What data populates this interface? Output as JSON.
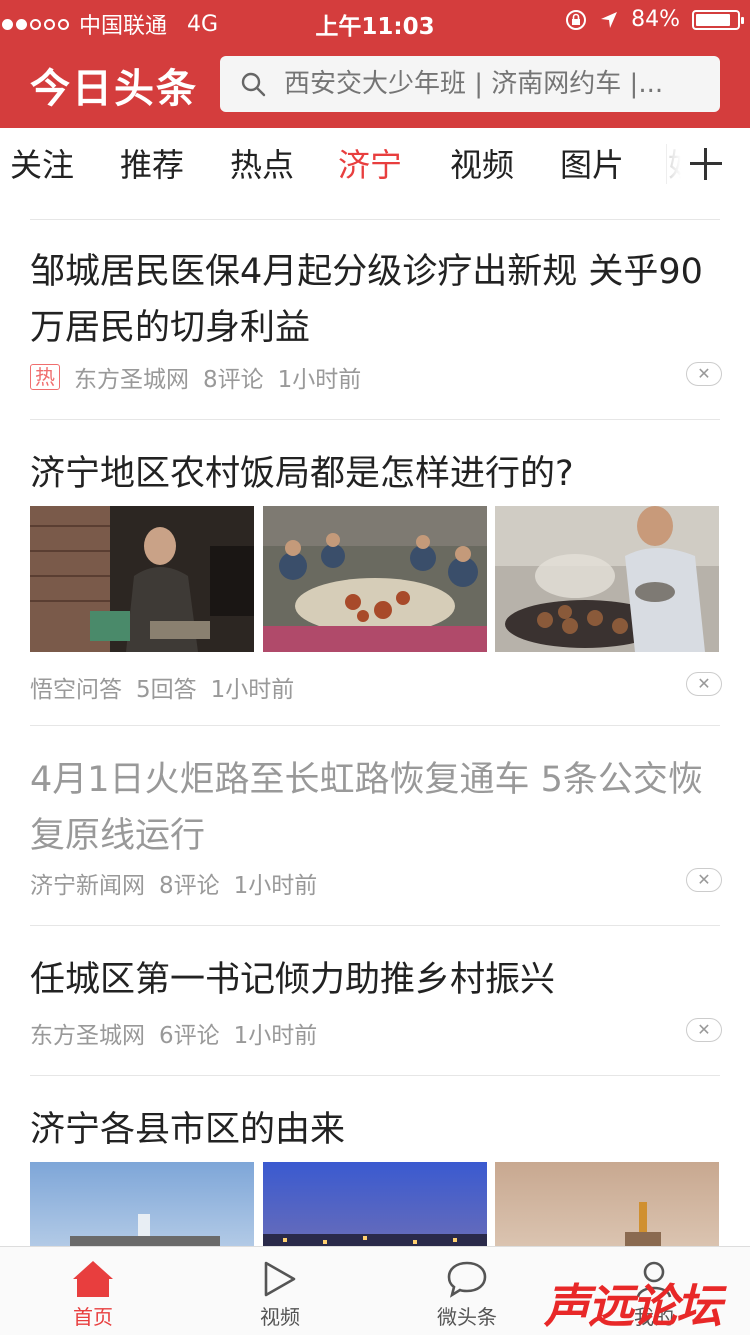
{
  "status_bar": {
    "carrier": "中国联通",
    "network": "4G",
    "time": "上午11:03",
    "battery_percent": "84%",
    "battery_level": 0.84,
    "signal_strength": 2
  },
  "header": {
    "logo": "今日头条",
    "search_placeholder": "西安交大少年班 | 济南网约车 |..."
  },
  "tabs": [
    {
      "label": "关注"
    },
    {
      "label": "推荐"
    },
    {
      "label": "热点"
    },
    {
      "label": "济宁",
      "active": true
    },
    {
      "label": "视频"
    },
    {
      "label": "图片"
    },
    {
      "label": "娱"
    }
  ],
  "articles": [
    {
      "title": "邹城居民医保4月起分级诊疗出新规 关乎90万居民的切身利益",
      "hot_tag": "热",
      "source": "东方圣城网",
      "comments": "8评论",
      "time": "1小时前"
    },
    {
      "title": "济宁地区农村饭局都是怎样进行的?",
      "source": "悟空问答",
      "comments": "5回答",
      "time": "1小时前"
    },
    {
      "title": "4月1日火炬路至长虹路恢复通车 5条公交恢复原线运行",
      "source": "济宁新闻网",
      "comments": "8评论",
      "time": "1小时前",
      "read": true
    },
    {
      "title": "任城区第一书记倾力助推乡村振兴",
      "source": "东方圣城网",
      "comments": "6评论",
      "time": "1小时前"
    },
    {
      "title": "济宁各县市区的由来"
    }
  ],
  "dismiss_label": "✕",
  "tabbar": {
    "home": "首页",
    "video": "视频",
    "micro": "微头条",
    "mine": "我的"
  },
  "watermark": "声远论坛",
  "colors": {
    "brand_red": "#d43d3d",
    "active_red": "#e83e3e",
    "text": "#222222",
    "muted": "#999999"
  }
}
